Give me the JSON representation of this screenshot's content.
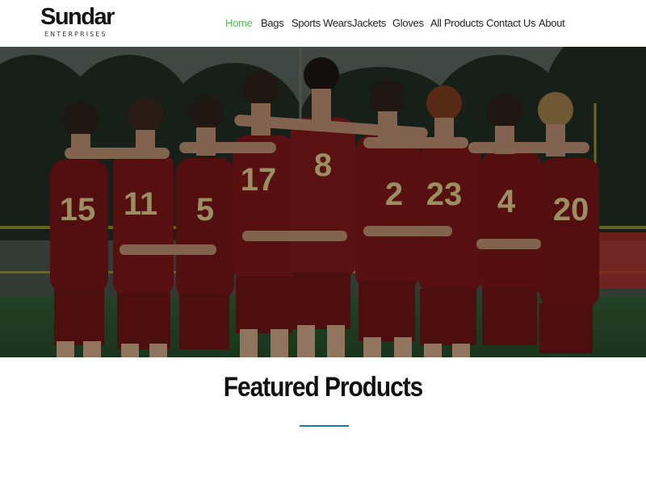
{
  "brand": {
    "name": "Sundar",
    "tagline": "ENTERPRISES"
  },
  "nav": {
    "items": [
      {
        "label": "Home",
        "active": true
      },
      {
        "label": "Bags",
        "active": false
      },
      {
        "label": "Sports Wears",
        "active": false
      },
      {
        "label": "Jackets",
        "active": false
      },
      {
        "label": "Gloves",
        "active": false
      },
      {
        "label": "All Products",
        "active": false
      },
      {
        "label": "Contact Us",
        "active": false
      },
      {
        "label": "About",
        "active": false
      }
    ],
    "active_color": "#5cb85c"
  },
  "hero": {
    "jersey_color": "#7a1717",
    "number_color": "#d8c58a",
    "player_numbers": [
      "15",
      "11",
      "5",
      "17",
      "8",
      "2",
      "23",
      "4",
      "20"
    ]
  },
  "featured": {
    "title": "Featured Products",
    "divider_color": "#1a73c9"
  }
}
